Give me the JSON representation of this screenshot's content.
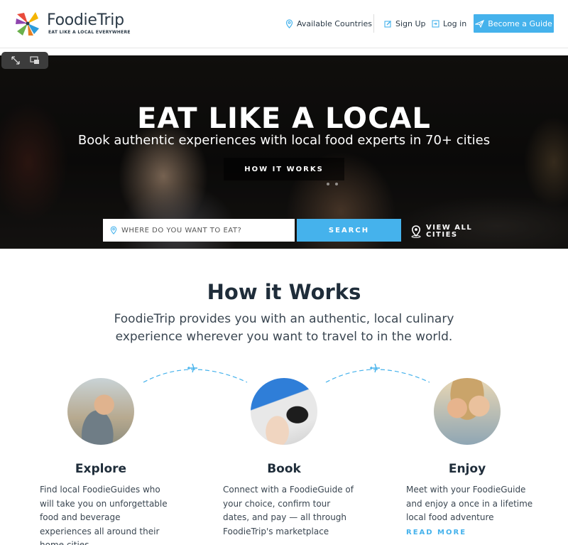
{
  "header": {
    "logo_name": "FoodieTrip",
    "logo_tagline": "EAT LIKE A LOCAL EVERYWHERE",
    "nav": {
      "countries": "Available Countries",
      "signup": "Sign Up",
      "login": "Log in",
      "guide": "Become a Guide"
    }
  },
  "hero": {
    "title": "EAT LIKE A LOCAL",
    "subtitle": "Book authentic experiences with local food experts in 70+ cities",
    "how_button": "HOW IT WORKS",
    "search_placeholder": "WHERE DO YOU WANT TO EAT?",
    "search_button": "SEARCH",
    "view_all": "VIEW ALL CITIES"
  },
  "how": {
    "title": "How it Works",
    "subtitle": "FoodieTrip provides you with an authentic, local culinary experience wherever you want to travel to in the world.",
    "steps": [
      {
        "title": "Explore",
        "text": "Find local FoodieGuides who will take you on unforgettable food and beverage experiences all around their home cities"
      },
      {
        "title": "Book",
        "text": "Connect with a FoodieGuide of your choice, confirm tour dates, and pay — all through FoodieTrip's marketplace"
      },
      {
        "title": "Enjoy",
        "text": "Meet with your FoodieGuide and enjoy a once in a lifetime local food adventure"
      }
    ],
    "read_more": "READ MORE"
  },
  "colors": {
    "accent": "#45b2ec",
    "heading": "#1f2d3a"
  },
  "icons": [
    "logo-pinwheel-icon",
    "map-pin-icon",
    "edit-icon",
    "login-icon",
    "plane-icon",
    "expand-icon",
    "picture-in-picture-icon",
    "location-icon"
  ]
}
